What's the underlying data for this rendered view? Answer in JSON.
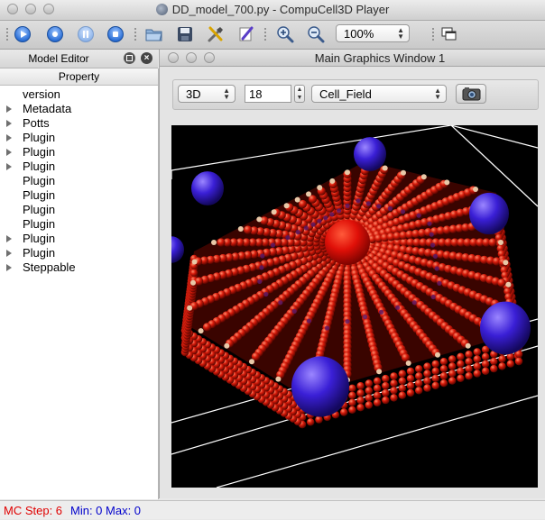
{
  "window": {
    "title": "DD_model_700.py - CompuCell3D Player"
  },
  "toolbar": {
    "zoom": "100%",
    "buttons": [
      "run-icon",
      "step-icon",
      "pause-icon",
      "stop-icon",
      "open-folder-icon",
      "save-icon",
      "tools-icon",
      "edit-icon",
      "zoom-in-icon",
      "zoom-out-icon",
      "windows-icon"
    ]
  },
  "model_editor": {
    "title": "Model Editor",
    "column_header": "Property",
    "items": [
      {
        "label": "version",
        "expandable": false
      },
      {
        "label": "Metadata",
        "expandable": true
      },
      {
        "label": "Potts",
        "expandable": true
      },
      {
        "label": "Plugin",
        "expandable": true
      },
      {
        "label": "Plugin",
        "expandable": true
      },
      {
        "label": "Plugin",
        "expandable": true
      },
      {
        "label": "Plugin",
        "expandable": false
      },
      {
        "label": "Plugin",
        "expandable": false
      },
      {
        "label": "Plugin",
        "expandable": false
      },
      {
        "label": "Plugin",
        "expandable": false
      },
      {
        "label": "Plugin",
        "expandable": true
      },
      {
        "label": "Plugin",
        "expandable": true
      },
      {
        "label": "Steppable",
        "expandable": true
      }
    ]
  },
  "graphics_window": {
    "title": "Main Graphics Window 1",
    "view_mode": "3D",
    "slice_value": "18",
    "field": "Cell_Field"
  },
  "status": {
    "mc_step_label": "MC Step: 6",
    "min_max_label": "Min: 0 Max: 0",
    "colors": {
      "mc_step": "#e00000",
      "min_max": "#0000cc"
    }
  },
  "scene_colors": {
    "background": "#000000",
    "cells": "#d61a0a",
    "boundary_cells": "#3a1fd6",
    "dots": "#e8c9a8",
    "frame": "#ffffff"
  }
}
